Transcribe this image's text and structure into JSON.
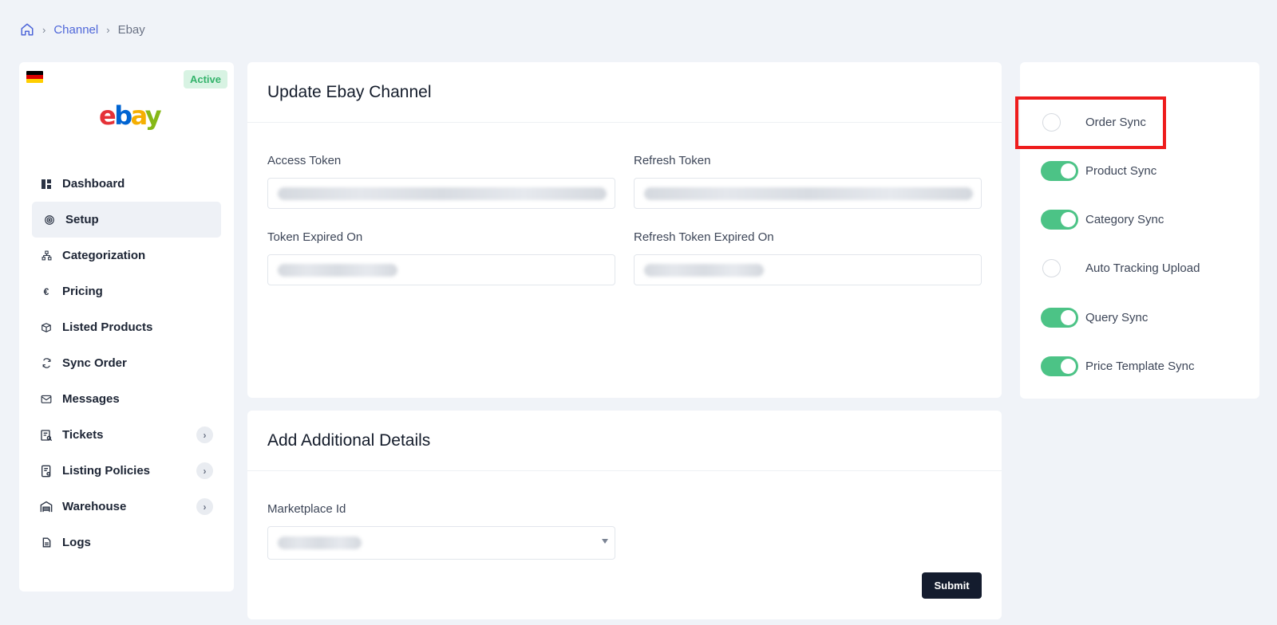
{
  "breadcrumb": {
    "home_icon": "home-icon",
    "items": [
      "Channel",
      "Ebay"
    ]
  },
  "sidebar": {
    "flag": {
      "country": "germany",
      "colors": [
        "#000000",
        "#dd0000",
        "#ffce00"
      ]
    },
    "status": "Active",
    "logo_text": "ebay",
    "items": [
      {
        "label": "Dashboard",
        "icon": "dashboard-icon",
        "active": false,
        "expandable": false
      },
      {
        "label": "Setup",
        "icon": "setup-icon",
        "active": true,
        "expandable": false
      },
      {
        "label": "Categorization",
        "icon": "categorization-icon",
        "active": false,
        "expandable": false
      },
      {
        "label": "Pricing",
        "icon": "euro-icon",
        "active": false,
        "expandable": false
      },
      {
        "label": "Listed Products",
        "icon": "box-icon",
        "active": false,
        "expandable": false
      },
      {
        "label": "Sync Order",
        "icon": "sync-icon",
        "active": false,
        "expandable": false
      },
      {
        "label": "Messages",
        "icon": "mail-icon",
        "active": false,
        "expandable": false
      },
      {
        "label": "Tickets",
        "icon": "ticket-icon",
        "active": false,
        "expandable": true
      },
      {
        "label": "Listing Policies",
        "icon": "policy-icon",
        "active": false,
        "expandable": true
      },
      {
        "label": "Warehouse",
        "icon": "warehouse-icon",
        "active": false,
        "expandable": true
      },
      {
        "label": "Logs",
        "icon": "file-icon",
        "active": false,
        "expandable": false
      }
    ]
  },
  "update_card": {
    "title": "Update Ebay Channel",
    "fields": {
      "access_token": {
        "label": "Access Token",
        "value": ""
      },
      "refresh_token": {
        "label": "Refresh Token",
        "value": ""
      },
      "token_expired_on": {
        "label": "Token Expired On",
        "value": ""
      },
      "refresh_token_expired_on": {
        "label": "Refresh Token Expired On",
        "value": ""
      }
    }
  },
  "details_card": {
    "title": "Add Additional Details",
    "marketplace_label": "Marketplace Id",
    "marketplace_value": "",
    "submit_label": "Submit"
  },
  "sync": {
    "items": [
      {
        "label": "Order Sync",
        "enabled": false
      },
      {
        "label": "Product Sync",
        "enabled": true
      },
      {
        "label": "Category Sync",
        "enabled": true
      },
      {
        "label": "Auto Tracking Upload",
        "enabled": false
      },
      {
        "label": "Query Sync",
        "enabled": true
      },
      {
        "label": "Price Template Sync",
        "enabled": true
      }
    ]
  },
  "colors": {
    "accent": "#4f67d9",
    "toggle_on": "#4cc386",
    "highlight": "#ee1c1c",
    "button": "#141c2e"
  }
}
